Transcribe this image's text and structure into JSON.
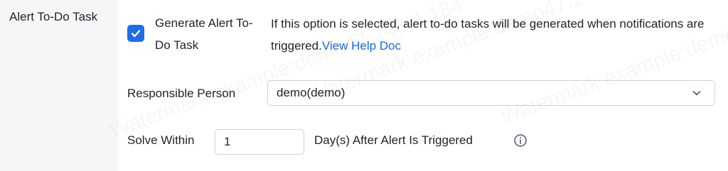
{
  "section": {
    "label": "Alert To-Do Task"
  },
  "generate": {
    "label": "Generate Alert To-Do Task",
    "checked": true,
    "description": "If this option is selected, alert to-do tasks will be generated when notifications are triggered.",
    "help_link": "View Help Doc"
  },
  "responsible": {
    "label": "Responsible Person",
    "value": "demo(demo)"
  },
  "solve": {
    "label": "Solve Within",
    "value": "1",
    "suffix": "Day(s) After Alert Is Triggered"
  },
  "watermark": {
    "text": "Watermark example:demo47.246.4.184"
  },
  "colors": {
    "accent": "#1c6ee8",
    "link": "#1468e8",
    "panel_bg": "#f5f6f7",
    "border": "#cfd3d8",
    "text": "#1f2329"
  },
  "icons": {
    "checkbox": "check-icon",
    "select": "chevron-down-icon",
    "info": "info-icon"
  }
}
